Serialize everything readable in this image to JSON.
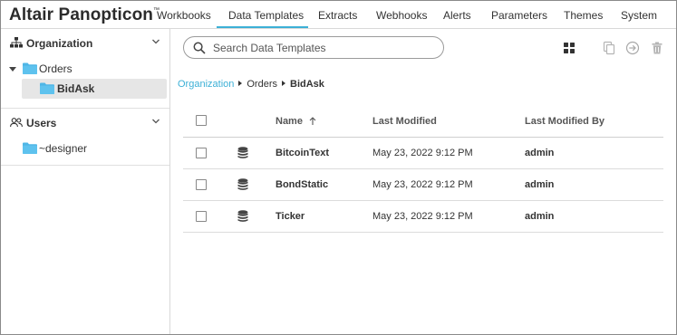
{
  "app": {
    "title": "Altair Panopticon",
    "trademark": "™"
  },
  "nav": {
    "tabs": [
      {
        "label": "Workbooks"
      },
      {
        "label": "Data Templates"
      },
      {
        "label": "Extracts"
      },
      {
        "label": "Webhooks"
      },
      {
        "label": "Alerts"
      },
      {
        "label": "Parameters"
      },
      {
        "label": "Themes"
      },
      {
        "label": "System"
      }
    ],
    "active": "Data Templates",
    "accent_color": "#3cb0d6"
  },
  "sidebar": {
    "organization": {
      "label": "Organization",
      "icon": "hierarchy-icon",
      "tree": [
        {
          "label": "Orders",
          "expanded": true,
          "icon": "folder-icon"
        },
        {
          "label": "BidAsk",
          "selected": true,
          "icon": "folder-icon"
        }
      ]
    },
    "users": {
      "label": "Users",
      "icon": "users-icon",
      "tree": [
        {
          "label": "~designer",
          "icon": "folder-icon"
        }
      ]
    },
    "folder_color": "#4fb6e6"
  },
  "search": {
    "placeholder": "Search Data Templates",
    "value": ""
  },
  "toolbar": {
    "icons": [
      "grid-view-icon",
      "copy-icon",
      "move-icon",
      "delete-icon"
    ]
  },
  "breadcrumb": {
    "items": [
      "Organization",
      "Orders",
      "BidAsk"
    ]
  },
  "table": {
    "columns": {
      "name": "Name",
      "modified": "Last Modified",
      "modified_by": "Last Modified By"
    },
    "sort": {
      "column": "Name",
      "direction": "ascending"
    },
    "rows": [
      {
        "name": "BitcoinText",
        "modified": "May 23, 2022 9:12 PM",
        "modified_by": "admin"
      },
      {
        "name": "BondStatic",
        "modified": "May 23, 2022 9:12 PM",
        "modified_by": "admin"
      },
      {
        "name": "Ticker",
        "modified": "May 23, 2022 9:12 PM",
        "modified_by": "admin"
      }
    ]
  }
}
